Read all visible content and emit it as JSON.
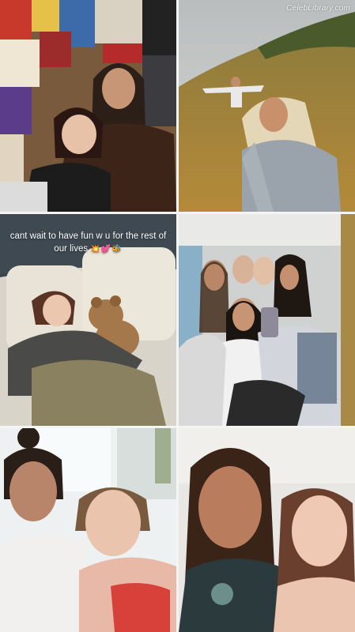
{
  "watermark": "CelebLibrary.com",
  "caption": {
    "text": "cant wait to have fun w u for the rest of our lives",
    "emoji": "💥💕🐝"
  },
  "cells": [
    {
      "scene": "Two girls hugging in front of a collage wall of posters"
    },
    {
      "scene": "Selfie on a grassy hillside, another person posing behind"
    },
    {
      "scene": "Girl lying in bed with a teddy bear"
    },
    {
      "scene": "Group of five girls posing for a selfie on a balcony"
    },
    {
      "scene": "Two girls selfie indoors by a window"
    },
    {
      "scene": "Two girls close-up selfie, one with braids"
    }
  ]
}
